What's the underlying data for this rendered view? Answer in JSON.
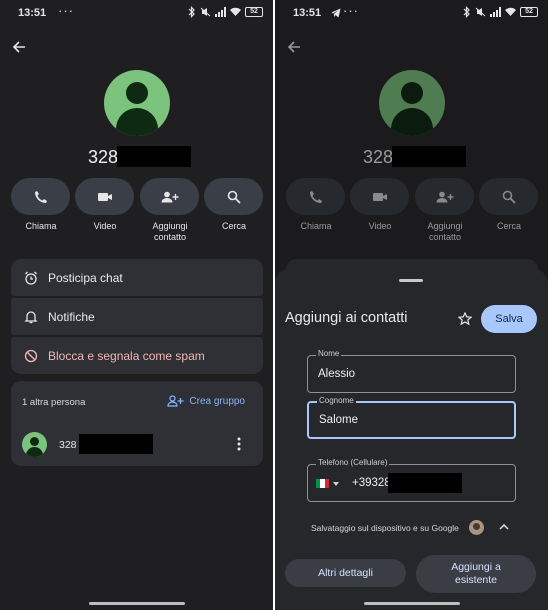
{
  "status_bar": {
    "time": "13:51",
    "dots": "···",
    "battery": "52"
  },
  "left": {
    "contact_number": "328",
    "actions": [
      {
        "label": "Chiama",
        "icon": "phone-icon"
      },
      {
        "label": "Video",
        "icon": "video-icon"
      },
      {
        "label": "Aggiungi\ncontatto",
        "icon": "add-person-icon"
      },
      {
        "label": "Cerca",
        "icon": "search-icon"
      }
    ],
    "menu": [
      {
        "label": "Posticipa chat",
        "icon": "alarm-icon",
        "color": "#eaeaea"
      },
      {
        "label": "Notifiche",
        "icon": "bell-icon",
        "color": "#eaeaea"
      },
      {
        "label": "Blocca e segnala come spam",
        "icon": "block-icon",
        "color": "#f2b8b5"
      }
    ],
    "group": {
      "count_label": "1 altra persona",
      "create_label": "Crea gruppo",
      "member_number": "328"
    }
  },
  "right": {
    "contact_number": "328",
    "sheet": {
      "title": "Aggiungi ai contatti",
      "save_label": "Salva",
      "fields": [
        {
          "label": "Nome",
          "value": "Alessio"
        },
        {
          "label": "Cognome",
          "value": "Salome"
        }
      ],
      "phone_label": "Telefono (Cellulare)",
      "phone_value": "+39328",
      "save_note": "Salvataggio sul dispositivo e su Google",
      "more_details_label": "Altri dettagli",
      "add_existing_label": "Aggiungi a\nesistente"
    }
  },
  "colors": {
    "accent": "#a8c7fa",
    "avatar": "#7cc37d",
    "link": "#8ab4f8"
  }
}
